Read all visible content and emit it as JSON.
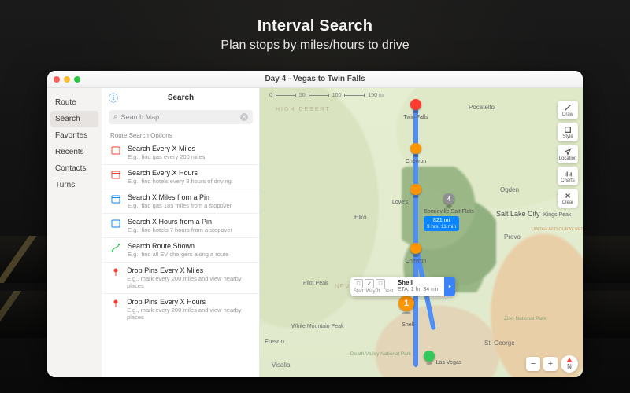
{
  "hero": {
    "title": "Interval Search",
    "subtitle": "Plan stops by miles/hours to drive"
  },
  "window": {
    "title": "Day 4 - Vegas to Twin Falls"
  },
  "nav": {
    "items": [
      {
        "label": "Route"
      },
      {
        "label": "Search"
      },
      {
        "label": "Favorites"
      },
      {
        "label": "Recents"
      },
      {
        "label": "Contacts"
      },
      {
        "label": "Turns"
      }
    ],
    "selected": 1
  },
  "panel": {
    "title": "Search",
    "search_placeholder": "Search Map",
    "section": "Route Search Options",
    "options": [
      {
        "icon": "calendar-red",
        "title": "Search Every X Miles",
        "sub": "E.g., find gas every 200 miles"
      },
      {
        "icon": "calendar-red",
        "title": "Search Every X Hours",
        "sub": "E.g., find hotels every 8 hours of driving."
      },
      {
        "icon": "calendar-blue",
        "title": "Search X Miles from a Pin",
        "sub": "E.g., find gas 185 miles from a stopover"
      },
      {
        "icon": "calendar-blue",
        "title": "Search X Hours from a Pin",
        "sub": "E.g., find hotels 7 hours from a stopover"
      },
      {
        "icon": "route-green",
        "title": "Search Route Shown",
        "sub": "E.g., find all EV chargers along a route"
      },
      {
        "icon": "pin-red",
        "title": "Drop Pins Every X Miles",
        "sub": "E.g., mark every 200 miles and view nearby places"
      },
      {
        "icon": "pin-red",
        "title": "Drop Pins Every X Hours",
        "sub": "E.g., mark every 200 miles and view nearby places"
      }
    ]
  },
  "map": {
    "scale": {
      "t0": "0",
      "t1": "50",
      "t2": "100",
      "t3": "150 mi"
    },
    "region_label": "HIGH DESERT",
    "cities": {
      "twinfalls": "Twin Falls",
      "pocatello": "Pocatello",
      "elko": "Elko",
      "saltlake": "Salt Lake City",
      "ogden": "Ogden",
      "provo": "Provo",
      "kingspeak": "Kings Peak",
      "stgeorge": "St. George",
      "lasvegas": "Las Vegas",
      "pilotpeak": "Pilot Peak",
      "whitemtn": "White Mountain Peak",
      "visalia": "Visalia",
      "fresno": "Fresno",
      "nevada": "NEVAD",
      "deathvalley": "Death Valley National Park",
      "zion": "Zion National Park",
      "uintah": "UINTAH AND OURAY RESERVATION"
    },
    "pins": {
      "dest": {
        "label": "Twin Falls"
      },
      "stop1": {
        "label": "Chevron"
      },
      "stop2": {
        "label": "Love's"
      },
      "bonn": {
        "label": "Bonneville Salt Flats",
        "num": "4"
      },
      "stop3": {
        "label": "Chevron"
      },
      "stop4": {
        "label": "Shell",
        "num": "1"
      },
      "start": {
        "label": "Las Vegas"
      }
    },
    "badge": {
      "l1": "821 mi",
      "l2": "9 hrs, 11 min"
    },
    "callout": {
      "seg": {
        "a": "▢",
        "b": "✓",
        "c": "▢",
        "la": "Start",
        "lb": "WayPt.",
        "lc": "Dest."
      },
      "title": "Shell",
      "eta": "ETA: 1 hr, 34 min",
      "go": "▸"
    },
    "tools": {
      "draw": "Draw",
      "style": "Style",
      "locate": "Location",
      "charts": "Charts",
      "clear": "Clear"
    },
    "compass": "N"
  }
}
